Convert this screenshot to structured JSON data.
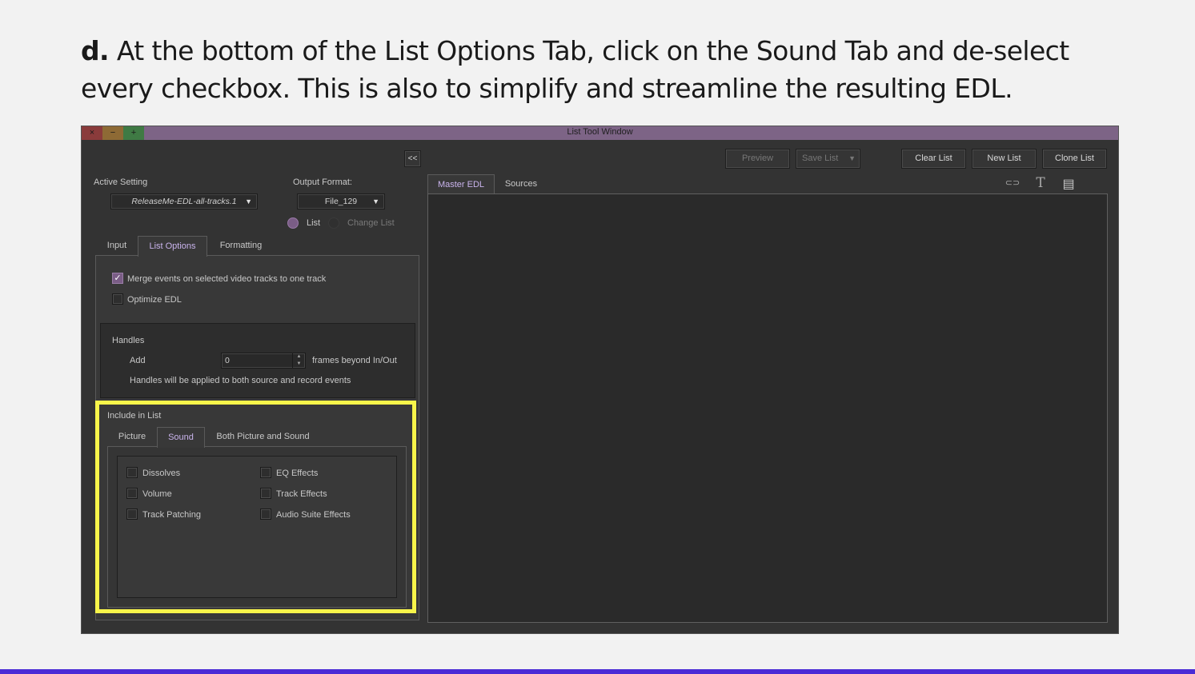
{
  "instruction": {
    "step": "d.",
    "text": "At the bottom of the List Options Tab, click on the Sound Tab and de-select every checkbox. This is also to simplify and streamline the resulting EDL."
  },
  "window": {
    "title": "List Tool Window",
    "close": "×",
    "minimize": "−",
    "maximize": "+"
  },
  "toolbar": {
    "collapse": "<<",
    "preview": "Preview",
    "save_list": "Save List",
    "clear_list": "Clear List",
    "new_list": "New List",
    "clone_list": "Clone List"
  },
  "settings": {
    "active_setting_label": "Active Setting",
    "active_setting_value": "ReleaseMe-EDL-all-tracks.1",
    "output_format_label": "Output Format:",
    "output_format_value": "File_129",
    "radio_list": "List",
    "radio_change_list": "Change List"
  },
  "tabs": {
    "input": "Input",
    "list_options": "List Options",
    "formatting": "Formatting"
  },
  "list_options": {
    "merge_events": "Merge events on selected video tracks to one track",
    "optimize_edl": "Optimize EDL"
  },
  "handles": {
    "title": "Handles",
    "add_label": "Add",
    "add_value": "0",
    "frames_label": "frames beyond In/Out",
    "note": "Handles will be applied to both source and record events"
  },
  "include": {
    "title": "Include in List",
    "tab_picture": "Picture",
    "tab_sound": "Sound",
    "tab_both": "Both Picture and Sound",
    "dissolves": "Dissolves",
    "volume": "Volume",
    "track_patching": "Track Patching",
    "eq_effects": "EQ Effects",
    "track_effects": "Track Effects",
    "audio_suite": "Audio Suite Effects"
  },
  "right_tabs": {
    "master_edl": "Master EDL",
    "sources": "Sources"
  },
  "colors": {
    "accent": "#7a5d86",
    "highlight": "#f8f54a",
    "titlebar": "#7d6486",
    "bottom_bar": "#4a2bd6"
  }
}
